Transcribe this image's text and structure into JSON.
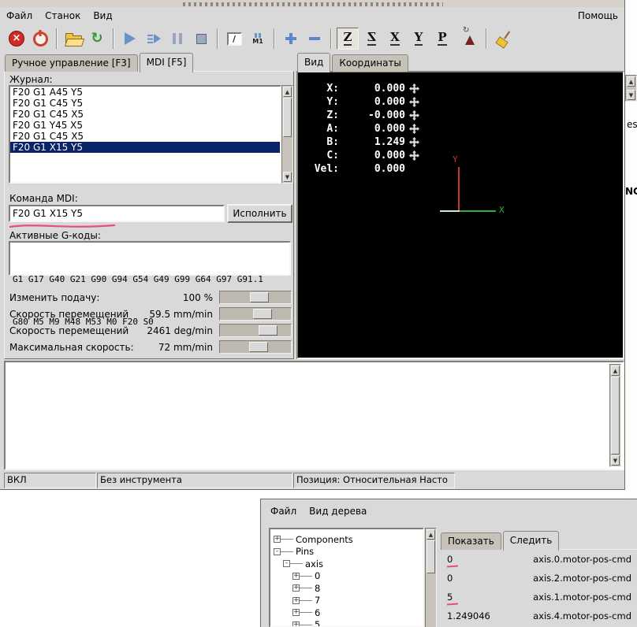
{
  "window": {
    "menu": [
      "Файл",
      "Станок",
      "Вид"
    ],
    "help": "Помощь"
  },
  "toolbar": {
    "block_delete": "/",
    "optional_stop": "M1",
    "view_z": "Z",
    "view_z2": "Z",
    "view_x": "X",
    "view_y": "Y",
    "view_p": "P"
  },
  "left": {
    "tab_manual": "Ручное управление [F3]",
    "tab_mdi": "MDI [F5]",
    "journal_label": "Журнал:",
    "journal_items": [
      "F20 G1 A45 Y5",
      "F20 G1 C45 Y5",
      "F20 G1 C45 X5",
      "F20 G1 Y45 X5",
      "F20 G1 C45 X5",
      "F20 G1 X15 Y5"
    ],
    "journal_selected": 5,
    "mdi_label": "Команда MDI:",
    "mdi_value": "F20 G1 X15 Y5",
    "execute_label": "Исполнить",
    "gcodes_label": "Активные G-коды:",
    "gcodes_lines": [
      "G1 G17 G40 G21 G90 G94 G54 G49 G99 G64 G97 G91.1",
      "G80 M5 M9 M48 M53 M0 F20 S0"
    ],
    "sliders": [
      {
        "label": "Изменить подачу:",
        "value": "100 %",
        "pct": 60
      },
      {
        "label": "Скорость перемещений",
        "value": "59.5 mm/min",
        "pct": 66
      },
      {
        "label": "Скорость перемещений",
        "value": "2461 deg/min",
        "pct": 76
      },
      {
        "label": "Максимальная скорость:",
        "value": "72 mm/min",
        "pct": 58
      }
    ]
  },
  "right": {
    "tab_view": "Вид",
    "tab_coords": "Координаты",
    "dro": [
      {
        "label": "X:",
        "value": "0.000",
        "icon": true
      },
      {
        "label": "Y:",
        "value": "0.000",
        "icon": true
      },
      {
        "label": "Z:",
        "value": "-0.000",
        "icon": true
      },
      {
        "label": "A:",
        "value": "0.000",
        "icon": true
      },
      {
        "label": "B:",
        "value": "1.249",
        "icon": true
      },
      {
        "label": "C:",
        "value": "0.000",
        "icon": true
      },
      {
        "label": "Vel:",
        "value": "0.000",
        "icon": false
      }
    ],
    "axis_x": "X",
    "axis_y": "Y"
  },
  "statusbar": [
    "ВКЛ",
    "Без инструмента",
    "Позиция: Относительная Насто"
  ],
  "hal": {
    "menu": [
      "Файл",
      "Вид дерева"
    ],
    "tree": [
      {
        "label": "Components",
        "depth": 0,
        "sym": "+"
      },
      {
        "label": "Pins",
        "depth": 0,
        "sym": "-"
      },
      {
        "label": "axis",
        "depth": 1,
        "sym": "-"
      },
      {
        "label": "0",
        "depth": 2,
        "sym": "+"
      },
      {
        "label": "8",
        "depth": 2,
        "sym": "+"
      },
      {
        "label": "7",
        "depth": 2,
        "sym": "+"
      },
      {
        "label": "6",
        "depth": 2,
        "sym": "+"
      },
      {
        "label": "5",
        "depth": 2,
        "sym": "+"
      }
    ],
    "tab_show": "Показать",
    "tab_watch": "Следить",
    "watch": [
      {
        "value": "0",
        "pin": "axis.0.motor-pos-cmd",
        "mark": true
      },
      {
        "value": "0",
        "pin": "axis.2.motor-pos-cmd",
        "mark": false
      },
      {
        "value": "5",
        "pin": "axis.1.motor-pos-cmd",
        "mark": true
      },
      {
        "value": "1.249046",
        "pin": "axis.4.motor-pos-cmd",
        "mark": false
      }
    ]
  },
  "fragments": {
    "a": "es",
    "b": "NC"
  },
  "annotation_color": "#e0507a"
}
